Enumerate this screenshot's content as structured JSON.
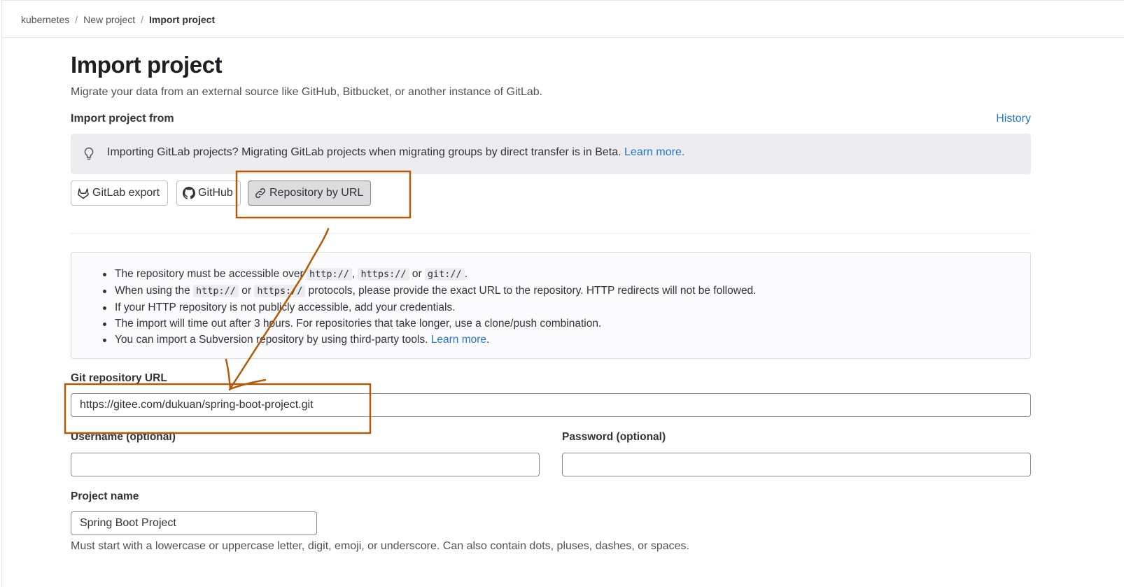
{
  "breadcrumb": {
    "items": [
      "kubernetes",
      "New project",
      "Import project"
    ],
    "separator": "/"
  },
  "page": {
    "title": "Import project",
    "subtitle": "Migrate your data from an external source like GitHub, Bitbucket, or another instance of GitLab.",
    "import_from_label": "Import project from",
    "history_link": "History"
  },
  "alert": {
    "icon": "lightbulb-icon",
    "text": "Importing GitLab projects? Migrating GitLab projects when migrating groups by direct transfer is in Beta.",
    "link": "Learn more."
  },
  "sources": [
    {
      "label": "GitLab export",
      "icon": "gitlab-icon",
      "selected": false
    },
    {
      "label": "GitHub",
      "icon": "github-icon",
      "selected": false
    },
    {
      "label": "Repository by URL",
      "icon": "link-icon",
      "selected": true
    }
  ],
  "info": {
    "line1": {
      "pre": "The repository must be accessible over ",
      "c1": "http://",
      "mid1": ", ",
      "c2": "https://",
      "mid2": " or ",
      "c3": "git://",
      "post": "."
    },
    "line2": {
      "pre": "When using the ",
      "c1": "http://",
      "mid": " or ",
      "c2": "https://",
      "post": " protocols, please provide the exact URL to the repository. HTTP redirects will not be followed."
    },
    "line3": "If your HTTP repository is not publicly accessible, add your credentials.",
    "line4": "The import will time out after 3 hours. For repositories that take longer, use a clone/push combination.",
    "line5": {
      "pre": "You can import a Subversion repository by using third-party tools. ",
      "link": "Learn more",
      "post": "."
    }
  },
  "form": {
    "url_label": "Git repository URL",
    "url_value": "https://gitee.com/dukuan/spring-boot-project.git",
    "username_label": "Username (optional)",
    "username_value": "",
    "password_label": "Password (optional)",
    "password_value": "",
    "project_name_label": "Project name",
    "project_name_value": "Spring Boot Project",
    "project_name_hint": "Must start with a lowercase or uppercase letter, digit, emoji, or underscore. Can also contain dots, pluses, dashes, or spaces."
  },
  "annotation": {
    "color": "#b05a0a"
  },
  "colors": {
    "link": "#1f75cb",
    "alert_bg": "#ececef",
    "selected_button_bg": "#dcdcde"
  }
}
